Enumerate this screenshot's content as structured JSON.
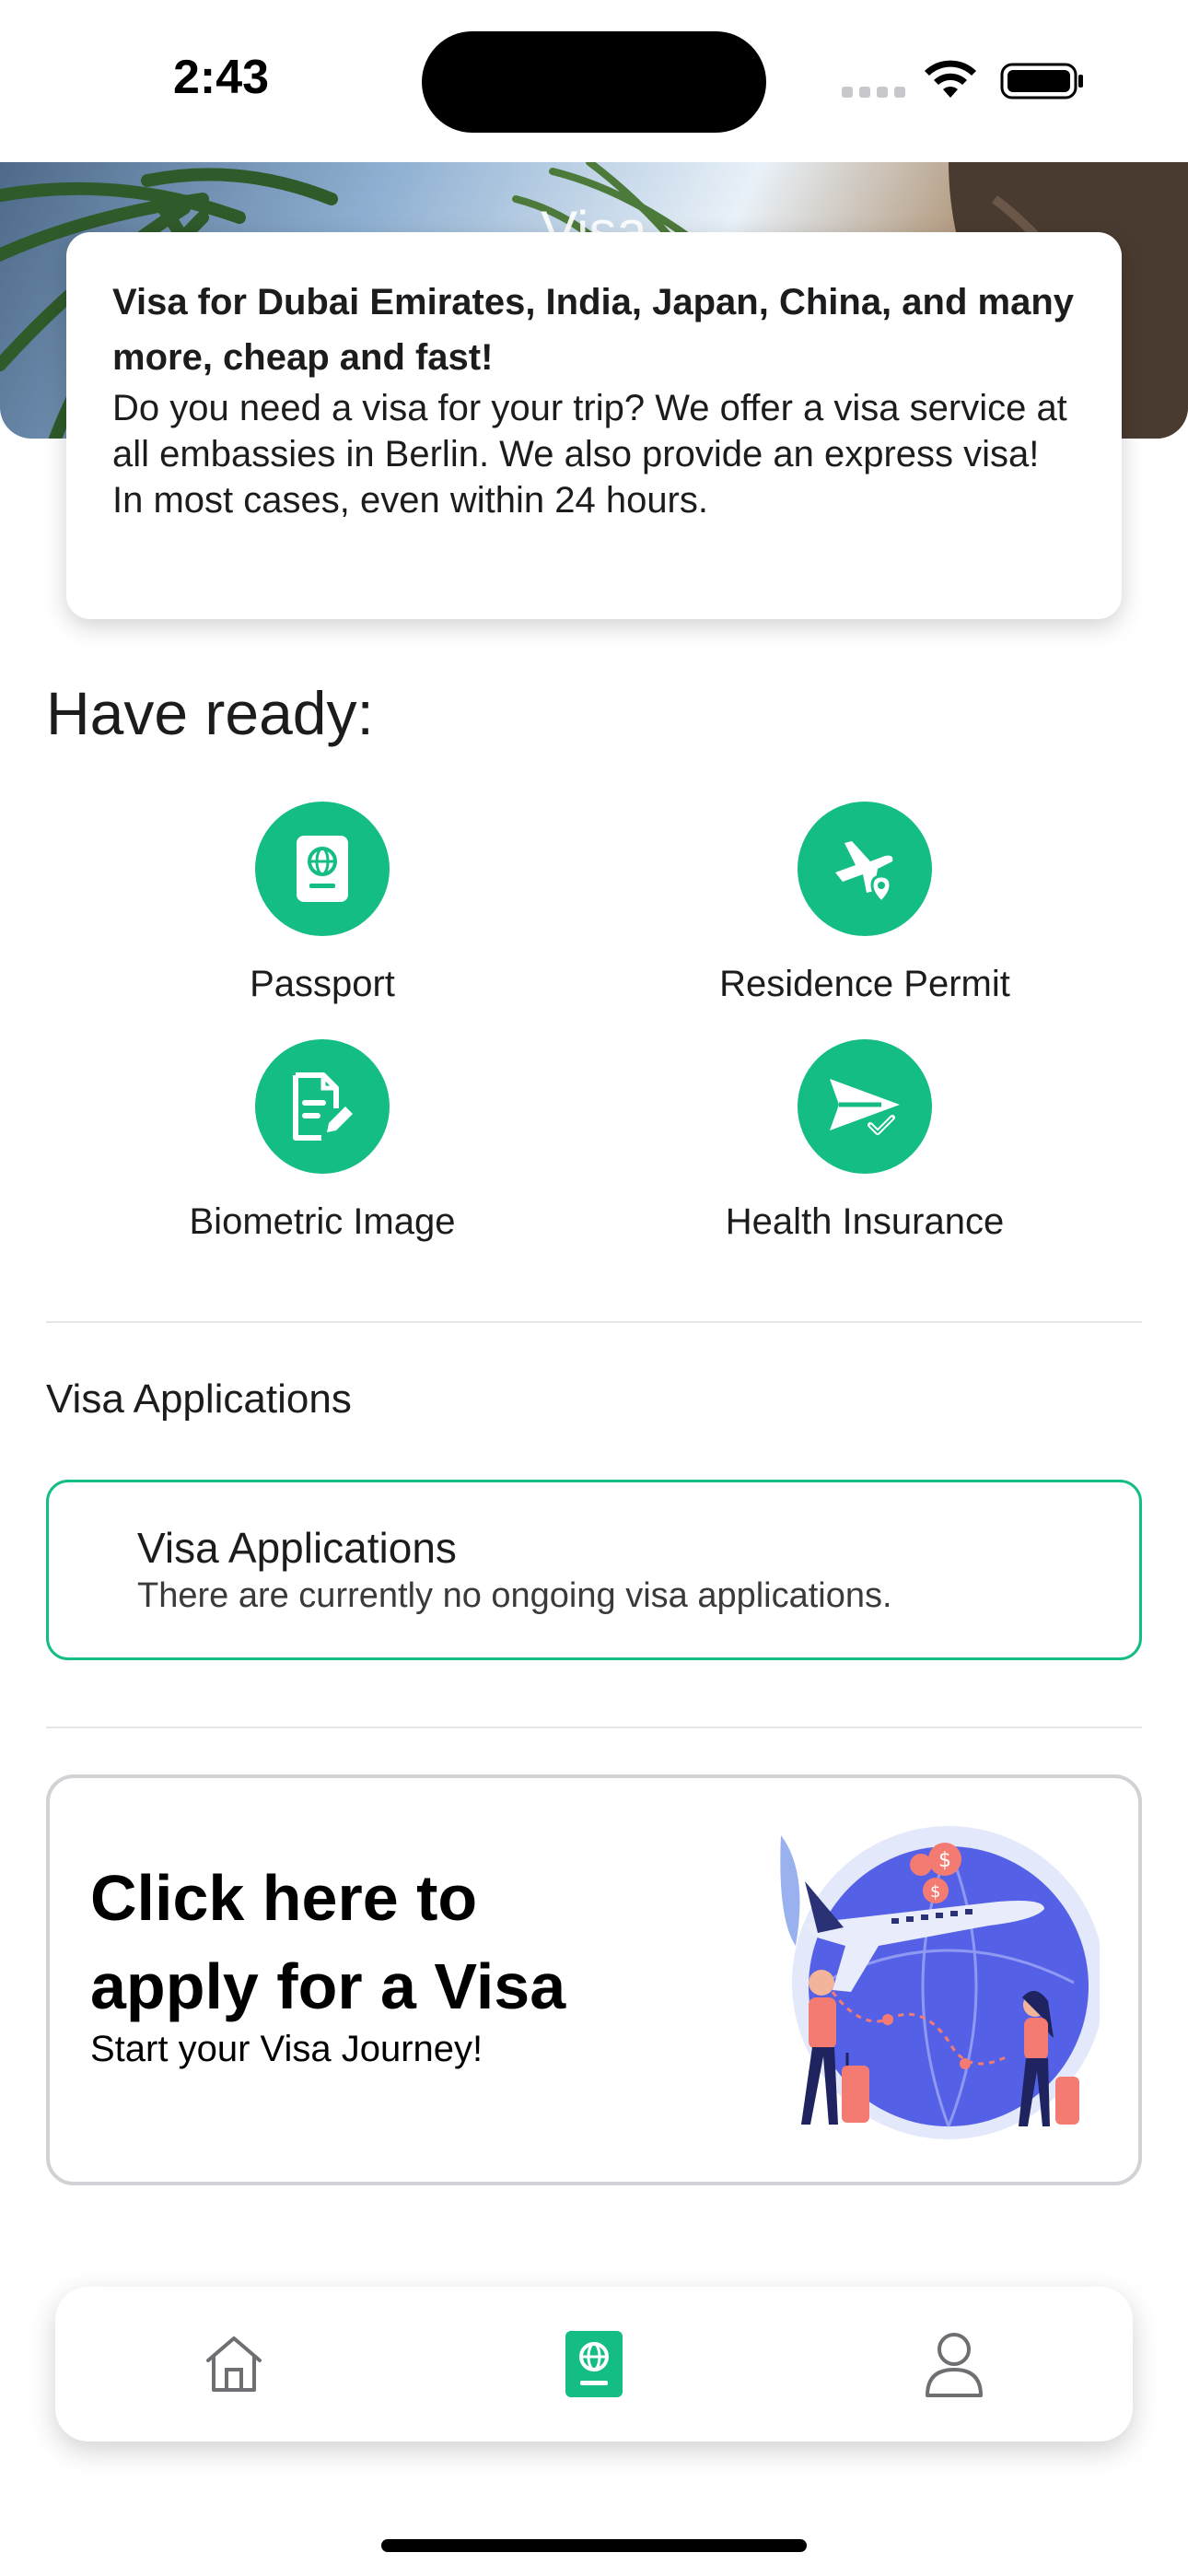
{
  "status_bar": {
    "time": "2:43"
  },
  "header": {
    "title": "Visa"
  },
  "intro": {
    "title": "Visa for Dubai Emirates, India, Japan, China, and many more, cheap and fast!",
    "body": "Do you need a visa for your trip? We offer a visa service at all embassies in Berlin. We also provide an express visa! In most cases, even within 24 hours."
  },
  "have_ready": {
    "heading": "Have ready:",
    "items": [
      {
        "label": "Passport",
        "icon": "passport-icon"
      },
      {
        "label": "Residence Permit",
        "icon": "plane-location-icon"
      },
      {
        "label": "Biometric Image",
        "icon": "document-edit-icon"
      },
      {
        "label": "Health Insurance",
        "icon": "paper-plane-check-icon"
      }
    ]
  },
  "applications": {
    "heading": "Visa Applications",
    "card_title": "Visa Applications",
    "card_text": "There are currently no ongoing visa applications."
  },
  "apply": {
    "title": "Click here to apply for a Visa",
    "subtitle": "Start your Visa Journey!"
  },
  "tab_bar": {
    "tabs": [
      {
        "name": "home",
        "icon": "home-icon",
        "active": false
      },
      {
        "name": "visa",
        "icon": "passport-icon",
        "active": true
      },
      {
        "name": "profile",
        "icon": "user-icon",
        "active": false
      }
    ]
  },
  "colors": {
    "accent": "#13bd84",
    "text": "#1c1c1e",
    "inactive_icon": "#6e6e73"
  }
}
